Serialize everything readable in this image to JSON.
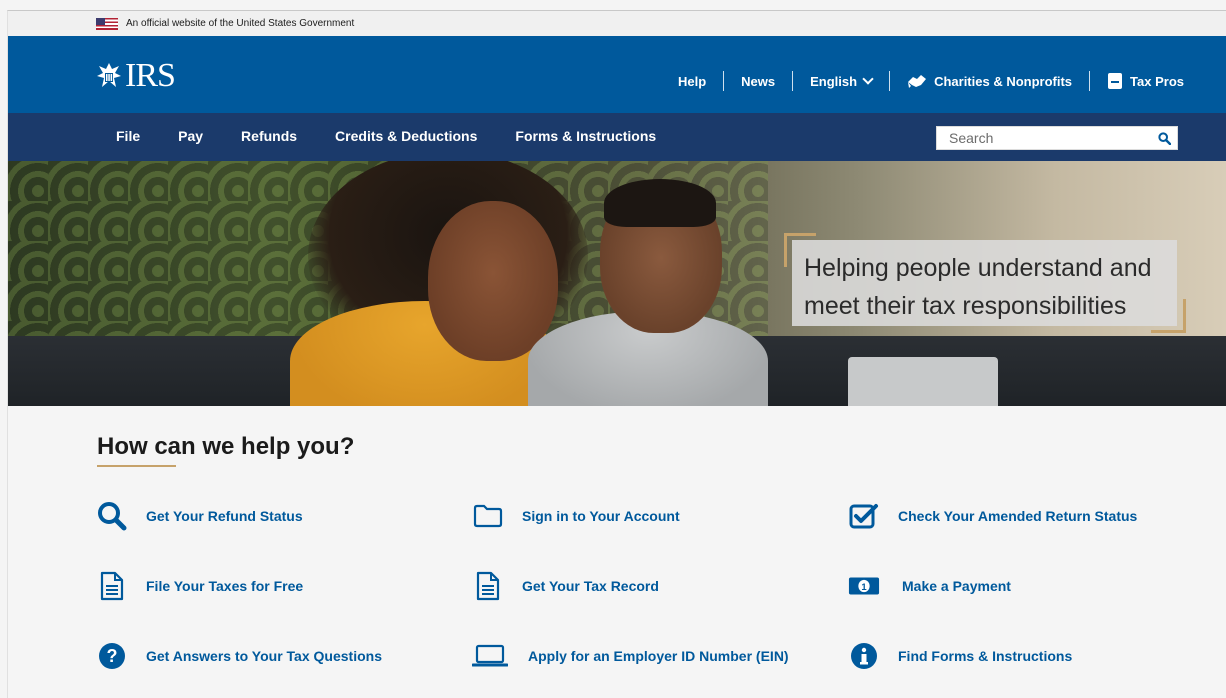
{
  "gov_banner": {
    "text": "An official website of the United States Government"
  },
  "header": {
    "logo_text": "IRS",
    "utility": [
      {
        "label": "Help"
      },
      {
        "label": "News"
      },
      {
        "label": "English"
      },
      {
        "label": "Charities & Nonprofits"
      },
      {
        "label": "Tax Pros"
      }
    ]
  },
  "nav": {
    "items": [
      "File",
      "Pay",
      "Refunds",
      "Credits & Deductions",
      "Forms & Instructions"
    ],
    "search_placeholder": "Search"
  },
  "hero": {
    "tagline_line1": "Helping people understand and",
    "tagline_line2": "meet their tax responsibilities"
  },
  "help": {
    "title": "How can we help you?",
    "tiles": [
      {
        "label": "Get Your Refund Status",
        "icon": "search-icon"
      },
      {
        "label": "Sign in to Your Account",
        "icon": "folder-icon"
      },
      {
        "label": "Check Your Amended Return Status",
        "icon": "checkbox-icon"
      },
      {
        "label": "File Your Taxes for Free",
        "icon": "document-icon"
      },
      {
        "label": "Get Your Tax Record",
        "icon": "document-icon"
      },
      {
        "label": "Make a Payment",
        "icon": "money-icon"
      },
      {
        "label": "Get Answers to Your Tax Questions",
        "icon": "question-icon"
      },
      {
        "label": "Apply for an Employer ID Number (EIN)",
        "icon": "laptop-icon"
      },
      {
        "label": "Find Forms & Instructions",
        "icon": "info-icon"
      }
    ]
  },
  "colors": {
    "brand_blue": "#00599c",
    "nav_navy": "#1b3a6b",
    "accent_gold": "#c6a26a"
  }
}
